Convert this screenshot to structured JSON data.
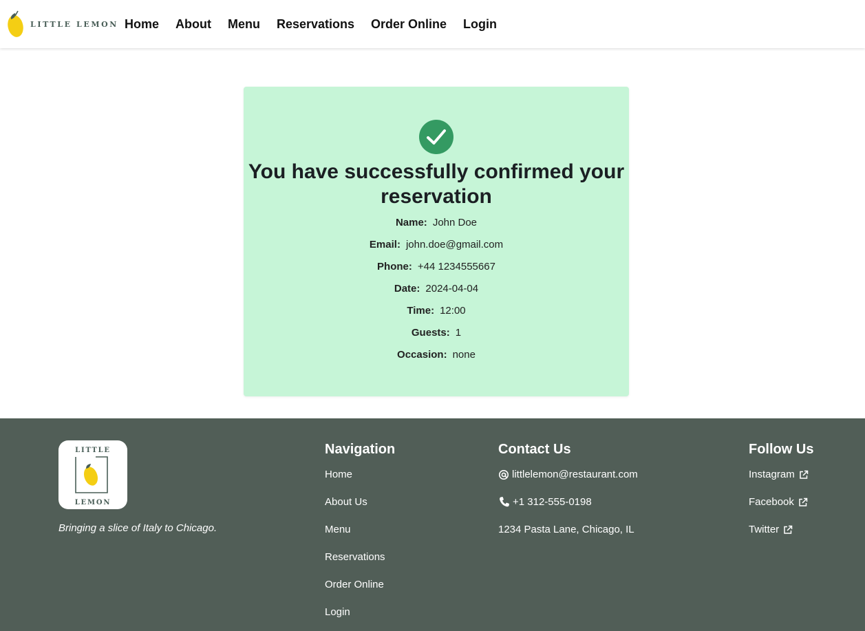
{
  "header": {
    "logo_text": "LITTLE LEMON",
    "nav": [
      "Home",
      "About",
      "Menu",
      "Reservations",
      "Order Online",
      "Login"
    ]
  },
  "confirmation": {
    "title": "You have successfully confirmed your reservation",
    "fields": [
      {
        "label": "Name:",
        "value": "John Doe"
      },
      {
        "label": "Email:",
        "value": "john.doe@gmail.com"
      },
      {
        "label": "Phone:",
        "value": "+44 1234555667"
      },
      {
        "label": "Date:",
        "value": "2024-04-04"
      },
      {
        "label": "Time:",
        "value": "12:00"
      },
      {
        "label": "Guests:",
        "value": "1"
      },
      {
        "label": "Occasion:",
        "value": "none"
      }
    ]
  },
  "footer": {
    "logo_top": "LITTLE",
    "logo_bottom": "LEMON",
    "tagline": "Bringing a slice of Italy to Chicago.",
    "navigation": {
      "heading": "Navigation",
      "items": [
        "Home",
        "About Us",
        "Menu",
        "Reservations",
        "Order Online",
        "Login"
      ]
    },
    "contact": {
      "heading": "Contact Us",
      "email": "littlelemon@restaurant.com",
      "phone": "+1 312-555-0198",
      "address": "1234 Pasta Lane, Chicago, IL"
    },
    "social": {
      "heading": "Follow Us",
      "items": [
        "Instagram",
        "Facebook",
        "Twitter"
      ]
    }
  },
  "colors": {
    "card_bg": "#c6f5d7",
    "check_green": "#349a62",
    "footer_bg": "#515e57",
    "lemon_yellow": "#f4ce14"
  }
}
